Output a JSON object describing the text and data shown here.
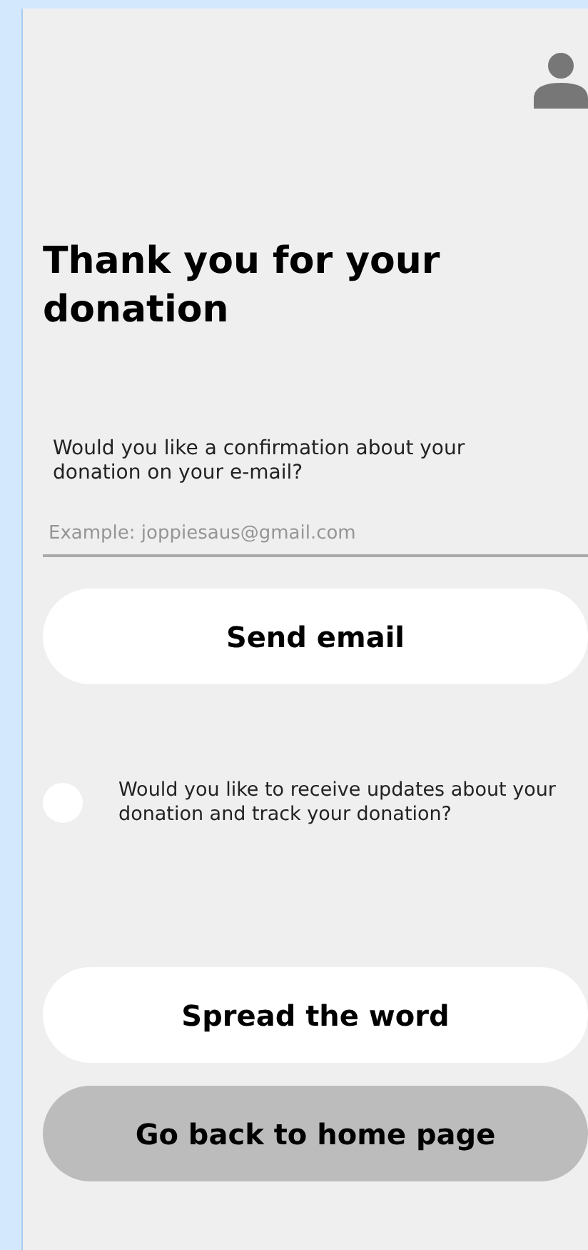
{
  "title": "Thank you for your donation",
  "email_section": {
    "question": "Would you like a confirmation about your donation on your e-mail?",
    "email_field": {
      "placeholder": "Example: joppiesaus@gmail.com"
    },
    "button": {
      "label": "Send email",
      "kind": "light"
    }
  },
  "updates_option": {
    "label": "Would you like to receive updates about your donation and track your donation?",
    "checked": false
  },
  "buttons": [
    {
      "label": "Spread the word",
      "kind": "light"
    },
    {
      "label": "Go back to home page",
      "kind": "grey"
    }
  ]
}
